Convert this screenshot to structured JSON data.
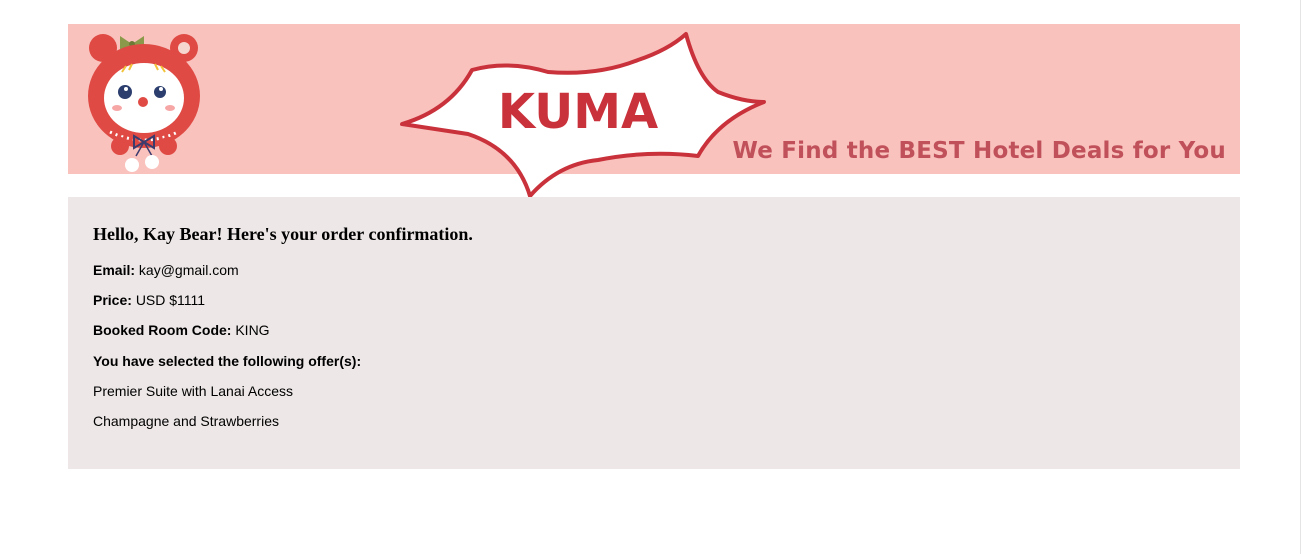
{
  "banner": {
    "logo_text": "KUMA",
    "tagline": "We Find the BEST Hotel Deals for You",
    "bg_color": "#f9c2bd",
    "logo_color": "#c9313b",
    "tagline_color": "#c0505a"
  },
  "confirmation": {
    "greeting": "Hello, Kay Bear! Here's your order confirmation.",
    "email_label": "Email:",
    "email_value": "kay@gmail.com",
    "price_label": "Price:",
    "price_value": "USD $1111",
    "room_label": "Booked Room Code:",
    "room_value": "KING",
    "offers_title": "You have selected the following offer(s):",
    "offers": [
      "Premier Suite with Lanai Access",
      "Champagne and Strawberries"
    ],
    "bg_color": "#ede7e7"
  },
  "icons": {
    "mascot": "bear-mascot-icon"
  }
}
